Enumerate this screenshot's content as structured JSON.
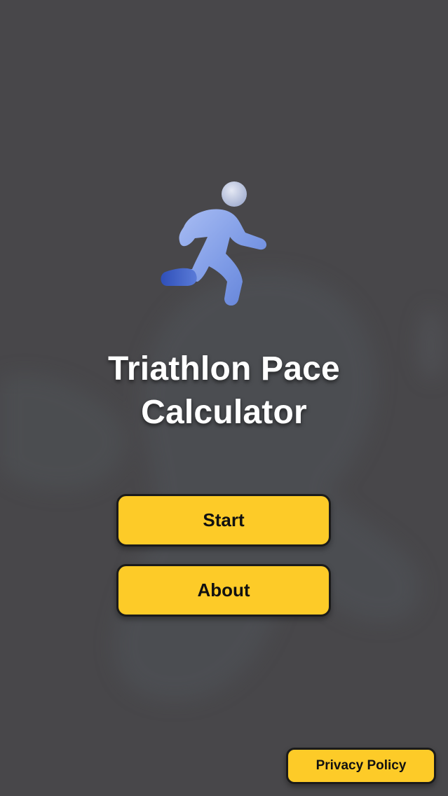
{
  "app": {
    "title_line1": "Triathlon Pace",
    "title_line2": "Calculator",
    "icon": "runner-icon"
  },
  "buttons": {
    "start_label": "Start",
    "about_label": "About",
    "privacy_label": "Privacy Policy"
  },
  "colors": {
    "background": "#48474a",
    "button": "#fdcb28",
    "button_border": "#1b1b1b",
    "icon_blue": "#7e9be6",
    "title_text": "#ffffff"
  }
}
